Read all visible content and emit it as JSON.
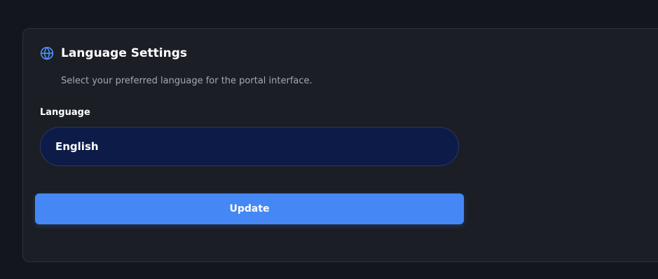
{
  "colors": {
    "page_background": "#13161c",
    "card_background": "#1b1e25",
    "select_background": "#0c1b47",
    "accent": "#4588f5"
  },
  "section": {
    "icon": "globe-icon",
    "title": "Language Settings",
    "description": "Select your preferred language for the portal interface."
  },
  "language_field": {
    "label": "Language",
    "selected_value": "English"
  },
  "update_button": {
    "label": "Update"
  }
}
